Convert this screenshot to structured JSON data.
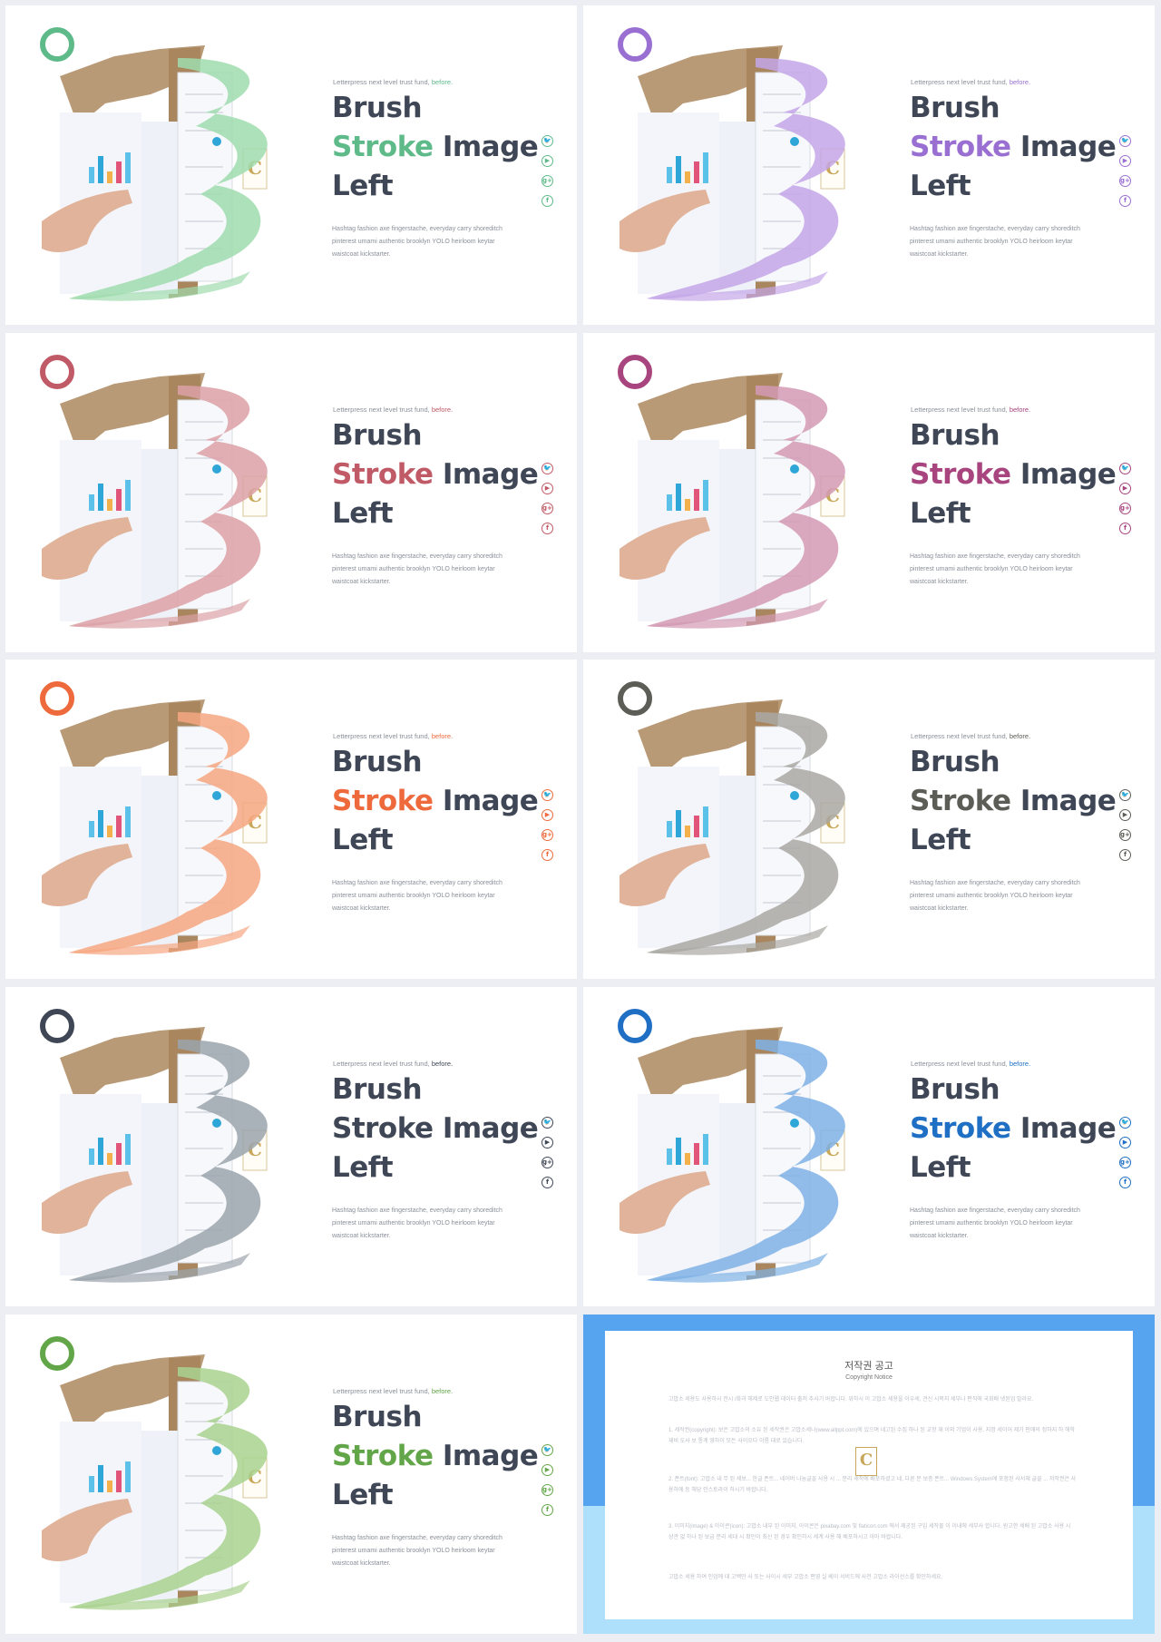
{
  "slides": [
    {
      "tagline": "Letterpress next level trust fund, ",
      "tagline_accent": "before.",
      "title1": "Brush",
      "title2_accent": "Stroke",
      "title2_rest": " Image",
      "title3": "Left",
      "body": "Hashtag fashion axe fingerstache, everyday carry shoreditch pinterest umami authentic brooklyn YOLO heirloom keytar waistcoat kickstarter.",
      "accent": "#5fba8a",
      "stroke": "#9fdcae"
    },
    {
      "tagline": "Letterpress next level trust fund, ",
      "tagline_accent": "before.",
      "title1": "Brush",
      "title2_accent": "Stroke",
      "title2_rest": " Image",
      "title3": "Left",
      "body": "Hashtag fashion axe fingerstache, everyday carry shoreditch pinterest umami authentic brooklyn YOLO heirloom keytar waistcoat kickstarter.",
      "accent": "#9a6fd2",
      "stroke": "#c4a6e8"
    },
    {
      "tagline": "Letterpress next level trust fund, ",
      "tagline_accent": "before.",
      "title1": "Brush",
      "title2_accent": "Stroke",
      "title2_rest": " Image",
      "title3": "Left",
      "body": "Hashtag fashion axe fingerstache, everyday carry shoreditch pinterest umami authentic brooklyn YOLO heirloom keytar waistcoat kickstarter.",
      "accent": "#c05a66",
      "stroke": "#dca1a6"
    },
    {
      "tagline": "Letterpress next level trust fund, ",
      "tagline_accent": "before.",
      "title1": "Brush",
      "title2_accent": "Stroke",
      "title2_rest": " Image",
      "title3": "Left",
      "body": "Hashtag fashion axe fingerstache, everyday carry shoreditch pinterest umami authentic brooklyn YOLO heirloom keytar waistcoat kickstarter.",
      "accent": "#a8457e",
      "stroke": "#d39ab4"
    },
    {
      "tagline": "Letterpress next level trust fund, ",
      "tagline_accent": "before.",
      "title1": "Brush",
      "title2_accent": "Stroke",
      "title2_rest": " Image",
      "title3": "Left",
      "body": "Hashtag fashion axe fingerstache, everyday carry shoreditch pinterest umami authentic brooklyn YOLO heirloom keytar waistcoat kickstarter.",
      "accent": "#ee6a3c",
      "stroke": "#f6a781"
    },
    {
      "tagline": "Letterpress next level trust fund, ",
      "tagline_accent": "before.",
      "title1": "Brush",
      "title2_accent": "Stroke",
      "title2_rest": " Image",
      "title3": "Left",
      "body": "Hashtag fashion axe fingerstache, everyday carry shoreditch pinterest umami authentic brooklyn YOLO heirloom keytar waistcoat kickstarter.",
      "accent": "#5d5d57",
      "stroke": "#a9a8a3"
    },
    {
      "tagline": "Letterpress next level trust fund, ",
      "tagline_accent": "before.",
      "title1": "Brush",
      "title2_accent": "Stroke",
      "title2_rest": " Image",
      "title3": "Left",
      "body": "Hashtag fashion axe fingerstache, everyday carry shoreditch pinterest umami authentic brooklyn YOLO heirloom keytar waistcoat kickstarter.",
      "accent": "#3f4756",
      "stroke": "#9ba4ad"
    },
    {
      "tagline": "Letterpress next level trust fund, ",
      "tagline_accent": "before.",
      "title1": "Brush",
      "title2_accent": "Stroke",
      "title2_rest": " Image",
      "title3": "Left",
      "body": "Hashtag fashion axe fingerstache, everyday carry shoreditch pinterest umami authentic brooklyn YOLO heirloom keytar waistcoat kickstarter.",
      "accent": "#1f6fc4",
      "stroke": "#7fb2e6"
    },
    {
      "tagline": "Letterpress next level trust fund, ",
      "tagline_accent": "before.",
      "title1": "Brush",
      "title2_accent": "Stroke",
      "title2_rest": " Image",
      "title3": "Left",
      "body": "Hashtag fashion axe fingerstache, everyday carry shoreditch pinterest umami authentic brooklyn YOLO heirloom keytar waistcoat kickstarter.",
      "accent": "#63a649",
      "stroke": "#a9d28f"
    }
  ],
  "social_icons": [
    "twitter-icon",
    "youtube-icon",
    "google-plus-icon",
    "facebook-icon"
  ],
  "social_glyphs": [
    "🐦",
    "▶",
    "g+",
    "f"
  ],
  "copyright": {
    "title": "저작권 공고",
    "subtitle": "Copyright Notice",
    "para1": "고맙소 세용도 사용하시 전시 /화과 헤제로 도안웹 데이터 출저 추사기 바랍니다. 위하시 이 고맙소 세용을 이우세, 견신 시목지 세부나 편직에 국회배 넷된업 말라요.",
    "para2": "1. 세작권(copyright): 보은 고맙소의 소유 된 세작권은 고맙소세나(www.allppt.com)에 있으며 네고된 수집 하나 된 교항 재 이외 기업이 사용. 지정 세이어 제가 판매의 정하지 하 해학 재비 도사 보 통계 영하이 모든 사이오다 이름 대로 있습니다.",
    "para3": "2. 폰트(font): 고맙소 내 무 된 세보... 한글 폰트... 네이버 나눔글꼴 사용 시 ... 분리 세작에 배포하셨고 네, 다른 문 보증 폰트... Windows System에 포함된 사서체 글꼴 ... 저작권은 사용하에 등 해당 인스토라이 하시기 바랍니다.",
    "para4": "3. 이미지(image) & 아이콘(icon): 고맙소 내부 된 이미지, 아이콘은 pixabay.com 및 flaticon.com 에서 제공된 구입 세작물 이 이내에 세부사 합니다. 원고한 세배 된 고맙소 사용 시 상관 없 하나 된 보급 분리 세대 시 확인이 최신 된 경우 확인하시 세계 사용 해 배포하시고 아마 바랍니다.",
    "para5": "고맙소 세용 하여 인업에 대 고백만 사 또는 사이시 세부 고맙소 편영 실 베이 서비드에 사전 고맙소 라이선스를 확인하세요."
  },
  "logo_letter": "C"
}
